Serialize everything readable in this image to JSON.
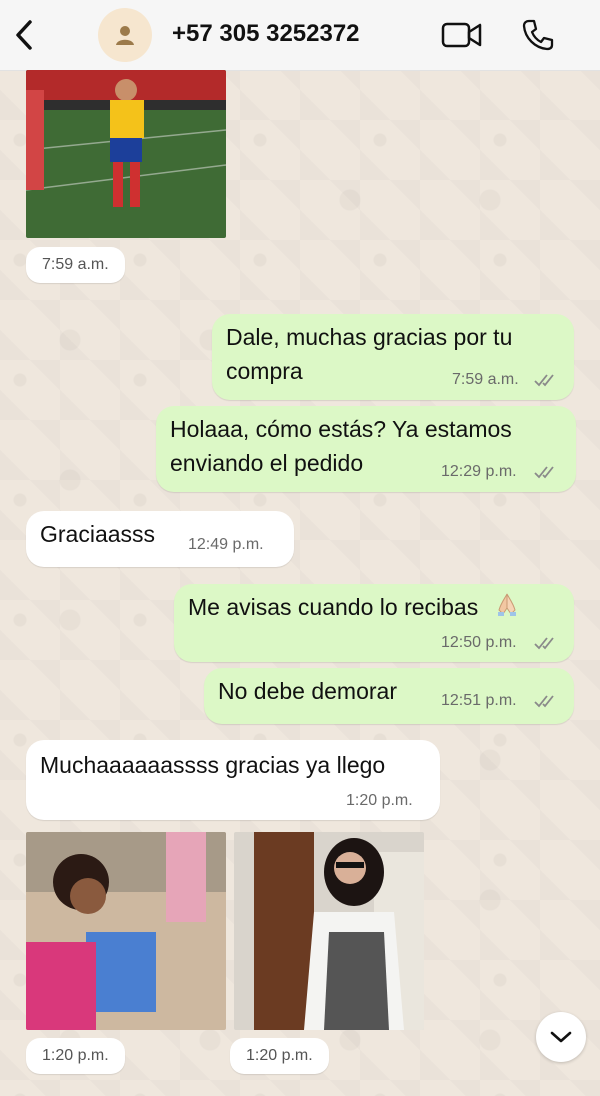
{
  "header": {
    "contact": "+57 305 3252372",
    "icons": {
      "back": "chevron-left-icon",
      "avatar": "person-icon",
      "video": "video-camera-icon",
      "phone": "phone-icon"
    }
  },
  "messages": [
    {
      "type": "image",
      "direction": "in",
      "time": "7:59 a.m."
    },
    {
      "type": "text",
      "direction": "out",
      "text_lines": [
        "Dale, muchas gracias por tu",
        "compra"
      ],
      "time": "7:59 a.m.",
      "status": "read"
    },
    {
      "type": "text",
      "direction": "out",
      "text_lines": [
        "Holaaa, cómo estás? Ya estamos",
        "enviando el pedido"
      ],
      "time": "12:29 p.m.",
      "status": "read"
    },
    {
      "type": "text",
      "direction": "in",
      "text": "Graciaasss",
      "time": "12:49 p.m."
    },
    {
      "type": "text",
      "direction": "out",
      "text": "Me avisas cuando lo recibas",
      "emoji": "🙏🏼",
      "time": "12:50 p.m.",
      "status": "read"
    },
    {
      "type": "text",
      "direction": "out",
      "text": "No debe demorar",
      "time": "12:51 p.m.",
      "status": "read"
    },
    {
      "type": "text",
      "direction": "in",
      "text": "Muchaaaaaassss gracias ya llego",
      "time": "1:20 p.m."
    },
    {
      "type": "image",
      "direction": "in",
      "time": "1:20 p.m."
    },
    {
      "type": "image",
      "direction": "in",
      "time": "1:20 p.m."
    }
  ],
  "colors": {
    "incoming": "#ffffff",
    "outgoing": "#dcf8c6",
    "wallpaper": "#efe7dd",
    "tick": "#8a8a8a"
  },
  "scroll_down_icon": "chevron-down-icon"
}
